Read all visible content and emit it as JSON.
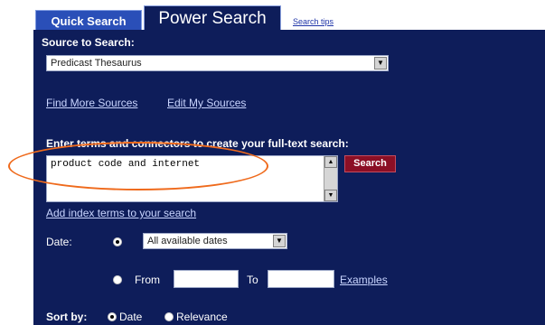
{
  "tabs": {
    "quick_search": "Quick Search",
    "power_search": "Power Search",
    "search_tips": "Search tips"
  },
  "source": {
    "title": "Source to Search:",
    "selected": "Predicast Thesaurus",
    "find_more": "Find More Sources",
    "edit_my": "Edit My Sources"
  },
  "terms": {
    "title": "Enter terms and connectors to create your full-text search:",
    "value": "product code and internet",
    "search_button": "Search",
    "add_index": "Add index terms to your search"
  },
  "date": {
    "label": "Date:",
    "selected_option": "All available dates",
    "from_label": "From",
    "to_label": "To",
    "from_value": "",
    "to_value": "",
    "examples": "Examples"
  },
  "sort": {
    "label": "Sort by:",
    "options": [
      "Date",
      "Relevance"
    ],
    "selected": "Date"
  },
  "colors": {
    "panel": "#0e1d5a",
    "quick_tab": "#2a4fb8",
    "search_button": "#8b0f25",
    "highlight": "#ef6a1c"
  }
}
